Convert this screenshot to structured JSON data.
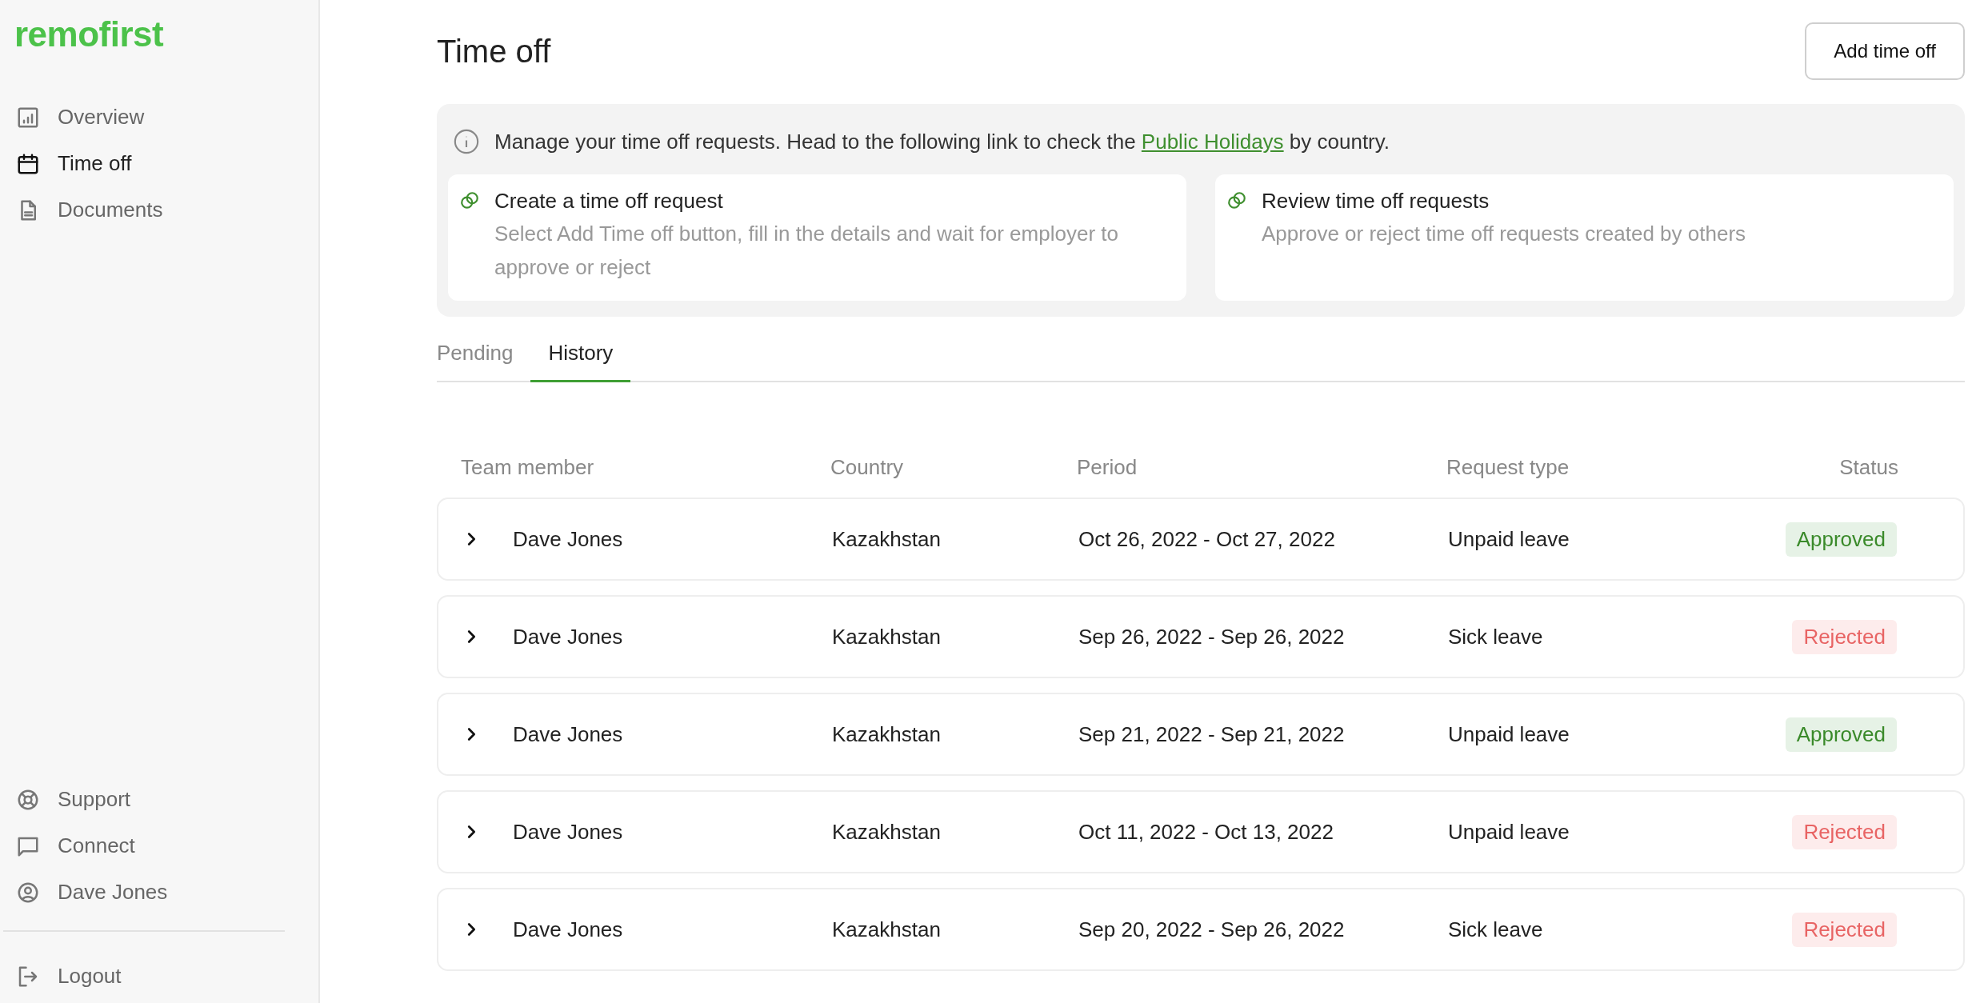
{
  "sidebar": {
    "logo": "remofirst",
    "items": [
      {
        "label": "Overview",
        "selected": false
      },
      {
        "label": "Time off",
        "selected": true
      },
      {
        "label": "Documents",
        "selected": false
      }
    ],
    "bottom_items": [
      {
        "label": "Support",
        "selected": false
      },
      {
        "label": "Connect",
        "selected": false
      },
      {
        "label": "Dave Jones",
        "selected": false
      }
    ],
    "logout": {
      "label": "Logout"
    }
  },
  "header": {
    "title": "Time off",
    "button": "Add time off"
  },
  "info": {
    "text_before": "Manage your time off requests. Head to the following link to check the",
    "link": "Public Holidays",
    "text_after": "by country.",
    "cards": [
      {
        "title": "Create a time off request",
        "description": "Select Add Time off button, fill in the details and wait for employer to approve or reject"
      },
      {
        "title": "Review time off requests",
        "description": "Approve or reject time off requests created by others"
      }
    ]
  },
  "tabs": [
    {
      "label": "Pending",
      "selected": false
    },
    {
      "label": "History",
      "selected": true
    }
  ],
  "table": {
    "columns": [
      "Team member",
      "Country",
      "Period",
      "Request type",
      "Status"
    ],
    "rows": [
      {
        "expanded": false,
        "team_member": "Dave Jones",
        "country": "Kazakhstan",
        "period": "Oct 26, 2022 - Oct 27, 2022",
        "request_type": "Unpaid leave",
        "status": {
          "text": "Approved",
          "kind": "approved"
        }
      },
      {
        "expanded": false,
        "team_member": "Dave Jones",
        "country": "Kazakhstan",
        "period": "Sep 26, 2022 - Sep 26, 2022",
        "request_type": "Sick leave",
        "status": {
          "text": "Rejected",
          "kind": "rejected"
        }
      },
      {
        "expanded": false,
        "team_member": "Dave Jones",
        "country": "Kazakhstan",
        "period": "Sep 21, 2022 - Sep 21, 2022",
        "request_type": "Unpaid leave",
        "status": {
          "text": "Approved",
          "kind": "approved"
        }
      },
      {
        "expanded": false,
        "team_member": "Dave Jones",
        "country": "Kazakhstan",
        "period": "Oct 11, 2022 - Oct 13, 2022",
        "request_type": "Unpaid leave",
        "status": {
          "text": "Rejected",
          "kind": "rejected"
        }
      },
      {
        "expanded": false,
        "team_member": "Dave Jones",
        "country": "Kazakhstan",
        "period": "Sep 20, 2022 - Sep 26, 2022",
        "request_type": "Sick leave",
        "status": {
          "text": "Rejected",
          "kind": "rejected"
        }
      }
    ]
  }
}
